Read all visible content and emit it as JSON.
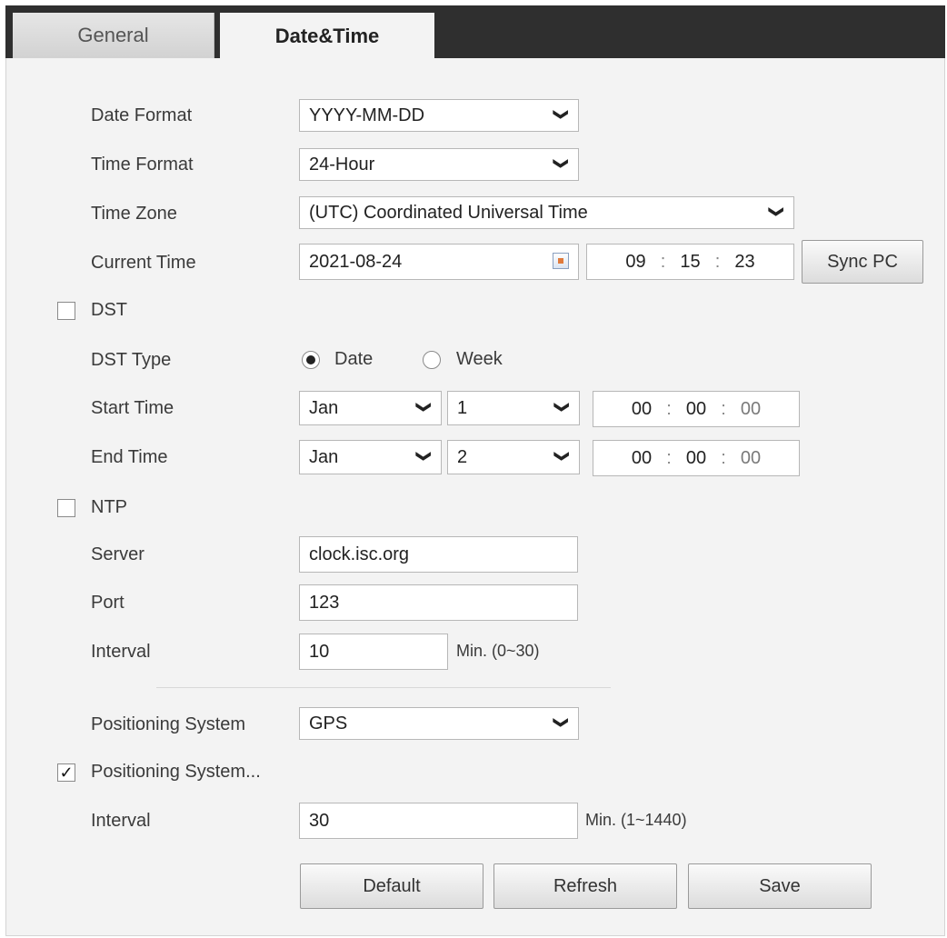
{
  "tabs": [
    {
      "label": "General",
      "active": false
    },
    {
      "label": "Date&Time",
      "active": true
    }
  ],
  "form": {
    "date_format": {
      "label": "Date Format",
      "value": "YYYY-MM-DD"
    },
    "time_format": {
      "label": "Time Format",
      "value": "24-Hour"
    },
    "time_zone": {
      "label": "Time Zone",
      "value": "(UTC) Coordinated Universal Time"
    },
    "current_time": {
      "label": "Current Time",
      "date": "2021-08-24",
      "hh": "09",
      "mm": "15",
      "ss": "23",
      "sync_label": "Sync PC"
    },
    "dst": {
      "label": "DST",
      "checked": false
    },
    "dst_type": {
      "label": "DST Type",
      "options": [
        "Date",
        "Week"
      ],
      "selected": "Date"
    },
    "start_time": {
      "label": "Start Time",
      "month": "Jan",
      "day": "1",
      "hh": "00",
      "mm": "00",
      "ss": "00"
    },
    "end_time": {
      "label": "End Time",
      "month": "Jan",
      "day": "2",
      "hh": "00",
      "mm": "00",
      "ss": "00"
    },
    "ntp": {
      "label": "NTP",
      "checked": false
    },
    "server": {
      "label": "Server",
      "value": "clock.isc.org"
    },
    "port": {
      "label": "Port",
      "value": "123"
    },
    "ntp_interval": {
      "label": "Interval",
      "value": "10",
      "unit": "Min. (0~30)"
    },
    "positioning_system": {
      "label": "Positioning System",
      "value": "GPS"
    },
    "positioning_sync": {
      "label": "Positioning System...",
      "checked": true
    },
    "pos_interval": {
      "label": "Interval",
      "value": "30",
      "unit": "Min. (1~1440)"
    },
    "separator": ":",
    "check_mark": "✓",
    "chevron": "❯"
  },
  "buttons": {
    "default": "Default",
    "refresh": "Refresh",
    "save": "Save"
  }
}
